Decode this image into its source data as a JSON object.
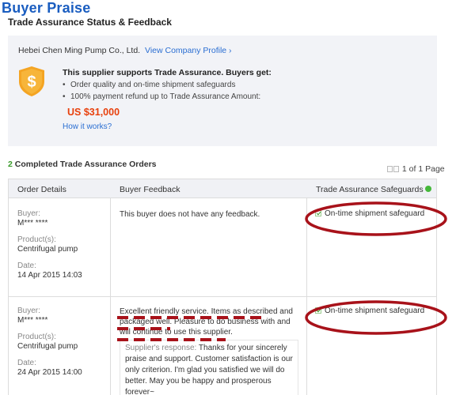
{
  "page": {
    "heading": "Buyer Praise",
    "section_title": "Trade Assurance Status & Feedback"
  },
  "assurance": {
    "company_name": "Hebei Chen Ming Pump Co., Ltd.",
    "profile_link": "View Company Profile ›",
    "headline": "This supplier supports Trade Assurance. Buyers get:",
    "bullets": [
      "Order quality and on-time shipment safeguards",
      "100% payment refund up to Trade Assurance Amount:"
    ],
    "amount": "US $31,000",
    "how_link": "How it works?",
    "shield_symbol": "$",
    "colors": {
      "shield": "#f4a423",
      "amount": "#e8400c",
      "link": "#2a6ed2",
      "panel_bg": "#f2f3f7"
    }
  },
  "orders": {
    "count": "2",
    "count_label": " Completed Trade Assurance Orders",
    "pager": "1 of 1 Page"
  },
  "table": {
    "headers": [
      "Order Details",
      "Buyer Feedback",
      "Trade Assurance Safeguards"
    ],
    "field_labels": {
      "buyer": "Buyer:",
      "products": "Product(s):",
      "date": "Date:"
    },
    "rows": [
      {
        "buyer": "M*** ****",
        "product": "Centrifugal pump",
        "date": "14 Apr 2015 14:03",
        "feedback": "This buyer does not have any feedback.",
        "safeguard": "On-time shipment safeguard"
      },
      {
        "buyer": "M*** ****",
        "product": "Centrifugal pump",
        "date": "24 Apr 2015 14:00",
        "feedback": "Excellent friendly service. Items as described and packaged well. Pleasure to do business with and will continue to use this supplier.",
        "reply_label": "Supplier's response:",
        "reply": "Thanks for your sincerely praise and support. Customer satisfaction is our only criterion. I'm glad you satisfied we will do better. May you be happy and prosperous forever~",
        "safeguard": "On-time shipment safeguard"
      }
    ]
  },
  "annotations": {
    "color": "#a8121a"
  }
}
